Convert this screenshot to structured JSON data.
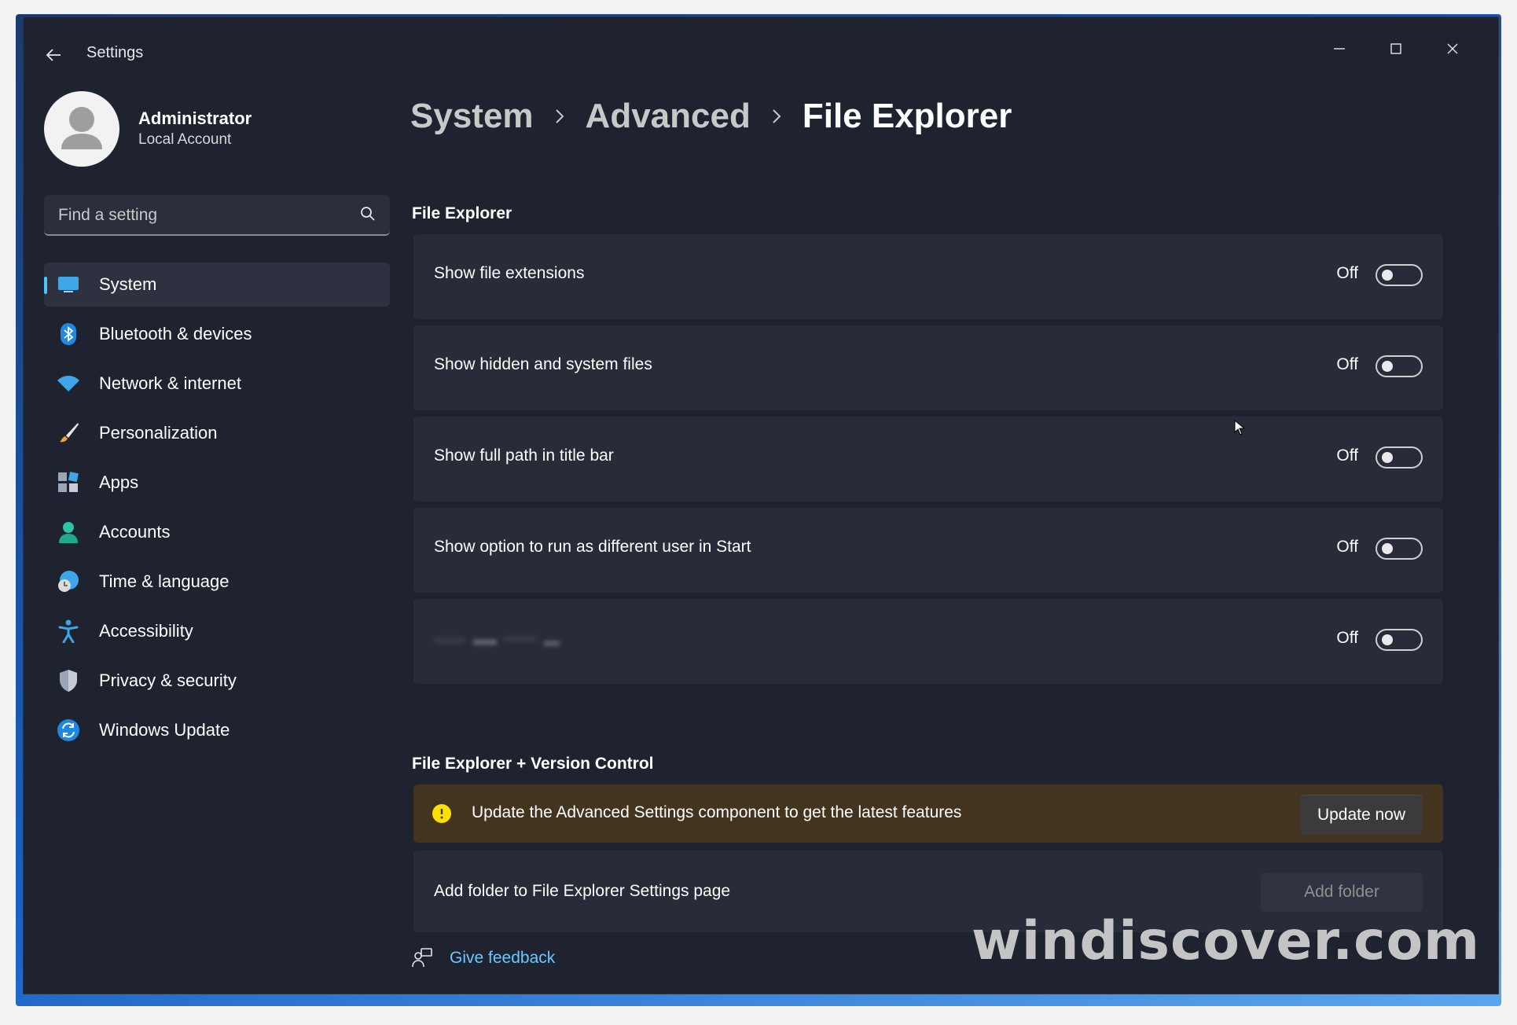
{
  "window": {
    "title": "Settings",
    "controls": [
      "minimize-icon",
      "maximize-icon",
      "close-icon"
    ]
  },
  "user": {
    "name": "Administrator",
    "account_type": "Local Account"
  },
  "search": {
    "placeholder": "Find a setting"
  },
  "sidebar": {
    "items": [
      {
        "label": "System",
        "icon": "system-icon",
        "active": true
      },
      {
        "label": "Bluetooth & devices",
        "icon": "bluetooth-icon"
      },
      {
        "label": "Network & internet",
        "icon": "wifi-icon"
      },
      {
        "label": "Personalization",
        "icon": "brush-icon"
      },
      {
        "label": "Apps",
        "icon": "apps-icon"
      },
      {
        "label": "Accounts",
        "icon": "accounts-icon"
      },
      {
        "label": "Time & language",
        "icon": "globe-clock-icon"
      },
      {
        "label": "Accessibility",
        "icon": "accessibility-icon"
      },
      {
        "label": "Privacy & security",
        "icon": "shield-icon"
      },
      {
        "label": "Windows Update",
        "icon": "update-icon"
      }
    ]
  },
  "breadcrumb": {
    "items": [
      "System",
      "Advanced",
      "File Explorer"
    ]
  },
  "file_explorer": {
    "title": "File Explorer",
    "settings": [
      {
        "label": "Show file extensions",
        "state": "Off"
      },
      {
        "label": "Show hidden and system files",
        "state": "Off"
      },
      {
        "label": "Show full path in title bar",
        "state": "Off"
      },
      {
        "label": "Show option to run as different user in Start",
        "state": "Off"
      },
      {
        "label": "",
        "state": "Off"
      }
    ]
  },
  "version_control": {
    "title": "File Explorer + Version Control",
    "warning_text": "Update the Advanced Settings component to get the latest features",
    "update_button": "Update now",
    "folder_label": "Add folder to File Explorer Settings page",
    "add_folder_button": "Add folder"
  },
  "feedback": {
    "label": "Give feedback"
  },
  "watermark": "windiscover.com",
  "colors": {
    "background": "#1f2330",
    "card": "#282c38",
    "accent": "#4cc2ff",
    "warning_bg": "#433420",
    "warning_icon": "#fce100",
    "link": "#6cc7ff"
  }
}
